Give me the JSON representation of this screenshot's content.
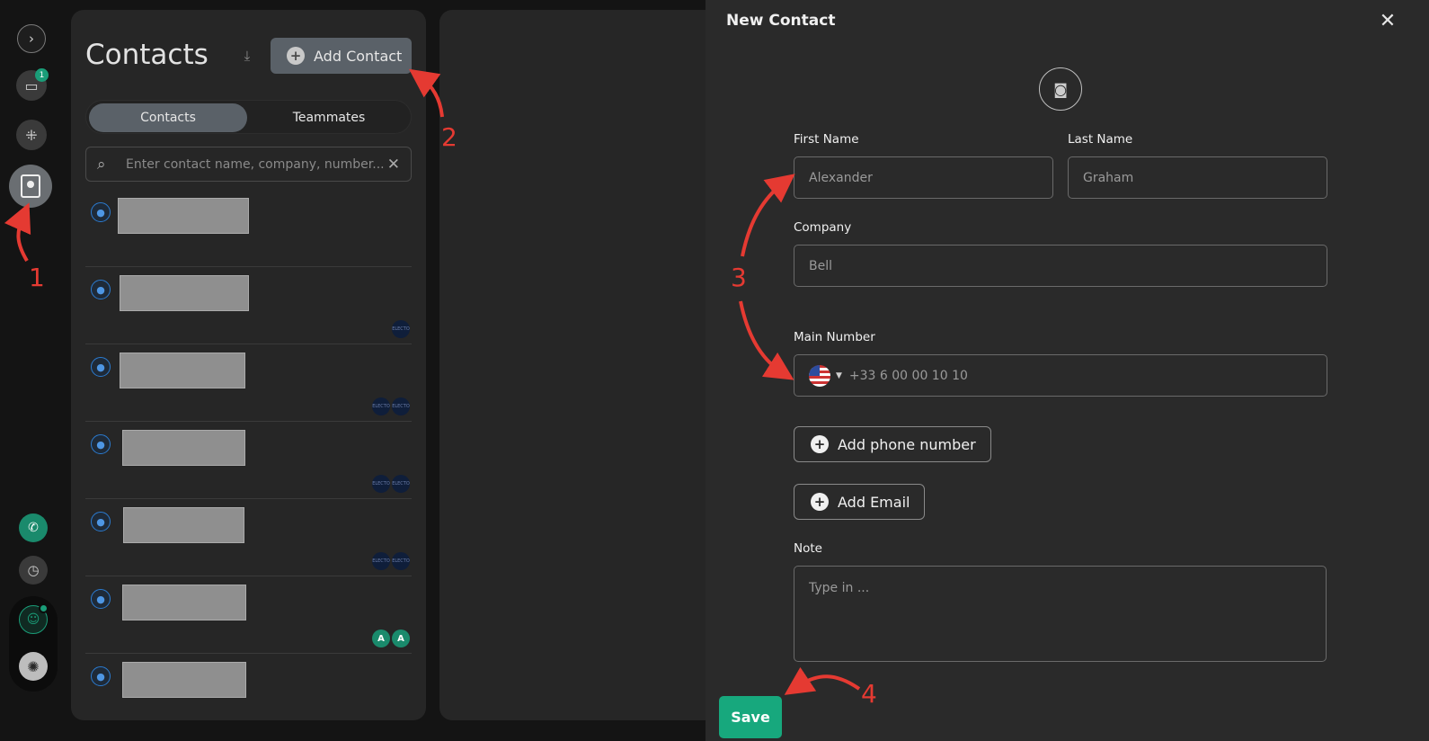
{
  "rail": {
    "inbox_badge": "1",
    "icons": [
      "expand-icon",
      "inbox-icon",
      "apps-icon",
      "contacts-icon",
      "dialer-icon",
      "history-icon",
      "user-status-icon",
      "help-icon"
    ]
  },
  "contacts_panel": {
    "title": "Contacts",
    "add_contact_label": "Add Contact",
    "tabs": [
      "Contacts",
      "Teammates"
    ],
    "active_tab": "Contacts",
    "search_placeholder": "Enter contact name, company, number...",
    "tag_text": "ELECTO",
    "rows": [
      {
        "tags": []
      },
      {
        "tags": [
          "ELECTO"
        ]
      },
      {
        "tags": [
          "ELECTO",
          "ELECTO"
        ]
      },
      {
        "tags": [
          "ELECTO",
          "ELECTO"
        ]
      },
      {
        "tags": [
          "ELECTO",
          "ELECTO"
        ]
      },
      {
        "tags": [
          "A",
          "A"
        ]
      },
      {
        "tags": []
      }
    ]
  },
  "new_contact": {
    "title": "New Contact",
    "first_name_label": "First Name",
    "first_name_placeholder": "Alexander",
    "last_name_label": "Last Name",
    "last_name_placeholder": "Graham",
    "company_label": "Company",
    "company_placeholder": "Bell",
    "main_number_label": "Main Number",
    "main_number_placeholder": "+33 6 00 00 10 10",
    "add_phone_label": "Add phone number",
    "add_email_label": "Add Email",
    "note_label": "Note",
    "note_placeholder": "Type in ...",
    "save_label": "Save"
  },
  "annotations": {
    "step1": "1",
    "step2": "2",
    "step3": "3",
    "step4": "4",
    "color": "#e53a32"
  },
  "colors": {
    "accent": "#17a87d",
    "button_gray": "#5a6168",
    "panel": "#262626"
  }
}
